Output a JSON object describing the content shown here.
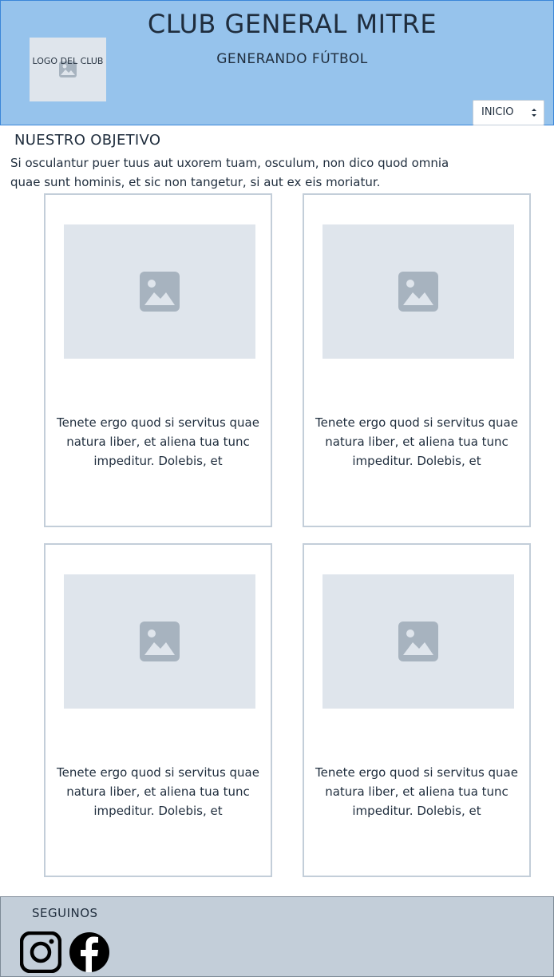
{
  "header": {
    "logo_text": "LOGO DEL CLUB",
    "title": "CLUB GENERAL MITRE",
    "subtitle": "GENERANDO FÚTBOL",
    "nav_select": {
      "selected": "INICIO"
    },
    "background_color": "#96c3ec"
  },
  "objective": {
    "heading": "NUESTRO OBJETIVO",
    "text": "Si osculantur puer tuus aut uxorem tuam, osculum, non dico quod omnia quae sunt hominis, et sic non tangetur, si aut ex eis moriatur."
  },
  "cards": [
    {
      "image_icon": "image-placeholder-icon",
      "text": "Tenete ergo quod si servitus quae natura liber, et aliena tua tunc impeditur. Dolebis, et"
    },
    {
      "image_icon": "image-placeholder-icon",
      "text": "Tenete ergo quod si servitus quae natura liber, et aliena tua tunc impeditur. Dolebis, et"
    },
    {
      "image_icon": "image-placeholder-icon",
      "text": "Tenete ergo quod si servitus quae natura liber, et aliena tua tunc impeditur. Dolebis, et"
    },
    {
      "image_icon": "image-placeholder-icon",
      "text": "Tenete ergo quod si servitus quae natura liber, et aliena tua tunc impeditur. Dolebis, et"
    }
  ],
  "footer": {
    "title": "SEGUINOS",
    "social": [
      {
        "icon": "instagram-icon"
      },
      {
        "icon": "facebook-icon"
      }
    ],
    "background_color": "#c3ced9"
  }
}
